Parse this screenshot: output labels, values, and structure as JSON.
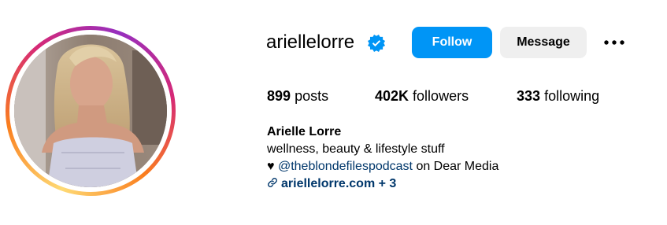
{
  "profile": {
    "username": "ariellelorre",
    "verified": true,
    "avatar": "profile-photo",
    "follow_label": "Follow",
    "message_label": "Message",
    "more_icon": "more-options-icon"
  },
  "stats": {
    "posts_count": "899",
    "posts_label": "posts",
    "followers_count": "402K",
    "followers_label": "followers",
    "following_count": "333",
    "following_label": "following"
  },
  "bio": {
    "name": "Arielle Lorre",
    "line1": "wellness, beauty & lifestyle stuff",
    "heart": "♥",
    "mention": "@theblondefilespodcast",
    "mention_suffix": "on Dear Media",
    "link_text": "ariellelorre.com + 3",
    "link_icon": "link-icon"
  },
  "colors": {
    "follow_button": "#0095f6",
    "message_button": "#efefef",
    "verified_badge": "#0095f6",
    "link": "#00376b"
  }
}
